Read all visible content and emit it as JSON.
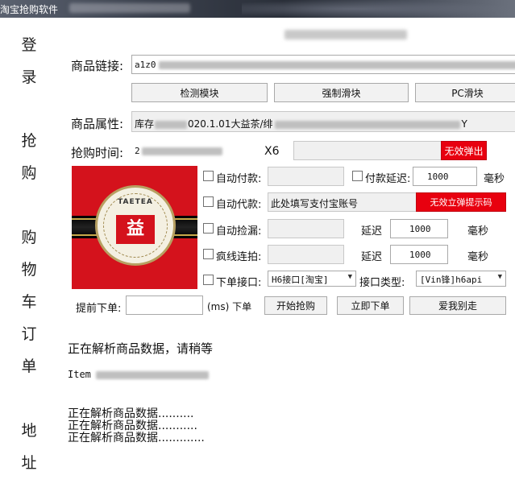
{
  "window": {
    "title": "淘宝抢购软件"
  },
  "sidebar": {
    "items": [
      {
        "label": "登\n录"
      },
      {
        "label": "抢\n购"
      },
      {
        "label": "购\n物\n车"
      },
      {
        "label": "订\n单"
      },
      {
        "label": "地\n址"
      }
    ]
  },
  "form": {
    "product_link_label": "商品链接:",
    "product_link_value": "a1z0",
    "buttons": {
      "detect": "检测模块",
      "force_slide": "强制滑块",
      "pc_slide": "PC滑块"
    },
    "product_attr_label": "商品属性:",
    "product_attr_prefix": "库存",
    "product_attr_mid": "020.1.01大益茶/绯",
    "product_attr_tail": "Y",
    "buy_time_label": "抢购时间:",
    "buy_time_value": "2",
    "multiplier": "X6",
    "invalid_popup_btn": "无效弹出",
    "auto_pay_label": "自动付款:",
    "pay_delay_label": "付款延迟:",
    "pay_delay_value": "1000",
    "ms_label_1": "毫秒",
    "auto_proxy_label": "自动代款:",
    "alipay_placeholder": "此处填写支付宝账号",
    "invalid_popup_code_btn": "无效立弹提示码",
    "auto_pickup_label": "自动捡漏:",
    "delay_label_1": "延迟",
    "delay_value_1": "1000",
    "ms_label_2": "毫秒",
    "crazy_click_label": "疯线连拍:",
    "delay_label_2": "延迟",
    "delay_value_2": "1000",
    "ms_label_3": "毫秒",
    "order_api_label": "下单接口:",
    "order_api_value": "H6接口[淘宝]",
    "api_type_label": "接口类型:",
    "api_type_value": "[Vin锋]h6api",
    "advance_order_label": "提前下单:",
    "advance_order_value": "",
    "advance_suffix": "(ms) 下单",
    "start_btn": "开始抢购",
    "order_now_btn": "立即下单",
    "love_btn": "爱我别走"
  },
  "logo": {
    "text": "TAETEA",
    "emblem": "益"
  },
  "status": {
    "parsing_wait": "正在解析商品数据，请稍等",
    "item_id_label": "Item",
    "log": [
      "正在解析商品数据..........",
      "正在解析商品数据...........",
      "正在解析商品数据............."
    ]
  },
  "colors": {
    "accent_red": "#e8000f",
    "title_bar": "#2a2f39"
  }
}
